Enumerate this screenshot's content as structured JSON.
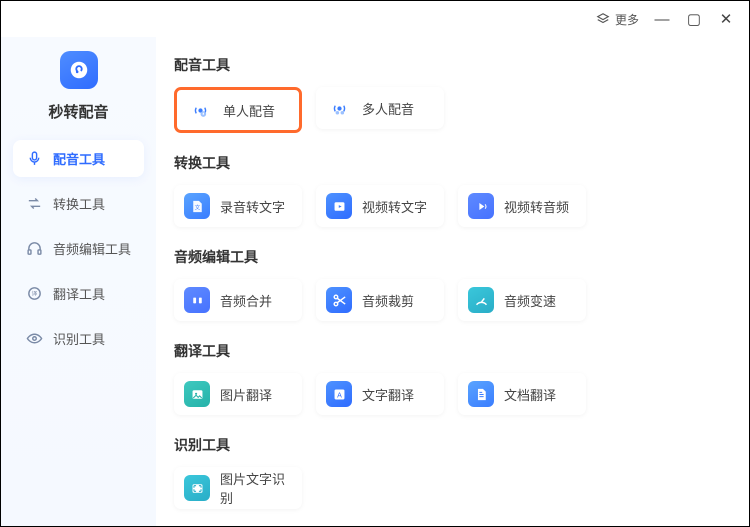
{
  "titlebar": {
    "more_label": "更多"
  },
  "app": {
    "name": "秒转配音"
  },
  "sidebar": {
    "items": [
      {
        "label": "配音工具",
        "icon": "mic"
      },
      {
        "label": "转换工具",
        "icon": "convert"
      },
      {
        "label": "音频编辑工具",
        "icon": "audio-edit"
      },
      {
        "label": "翻译工具",
        "icon": "translate"
      },
      {
        "label": "识别工具",
        "icon": "recognize"
      }
    ]
  },
  "sections": {
    "dubbing": {
      "title": "配音工具",
      "items": [
        {
          "label": "单人配音"
        },
        {
          "label": "多人配音"
        }
      ]
    },
    "convert": {
      "title": "转换工具",
      "items": [
        {
          "label": "录音转文字"
        },
        {
          "label": "视频转文字"
        },
        {
          "label": "视频转音频"
        }
      ]
    },
    "audioedit": {
      "title": "音频编辑工具",
      "items": [
        {
          "label": "音频合并"
        },
        {
          "label": "音频裁剪"
        },
        {
          "label": "音频变速"
        }
      ]
    },
    "translate": {
      "title": "翻译工具",
      "items": [
        {
          "label": "图片翻译"
        },
        {
          "label": "文字翻译"
        },
        {
          "label": "文档翻译"
        }
      ]
    },
    "recognize": {
      "title": "识别工具",
      "items": [
        {
          "label": "图片文字识别"
        }
      ]
    }
  },
  "colors": {
    "accent": "#2f6cff",
    "highlight_border": "#ff6a2c"
  }
}
